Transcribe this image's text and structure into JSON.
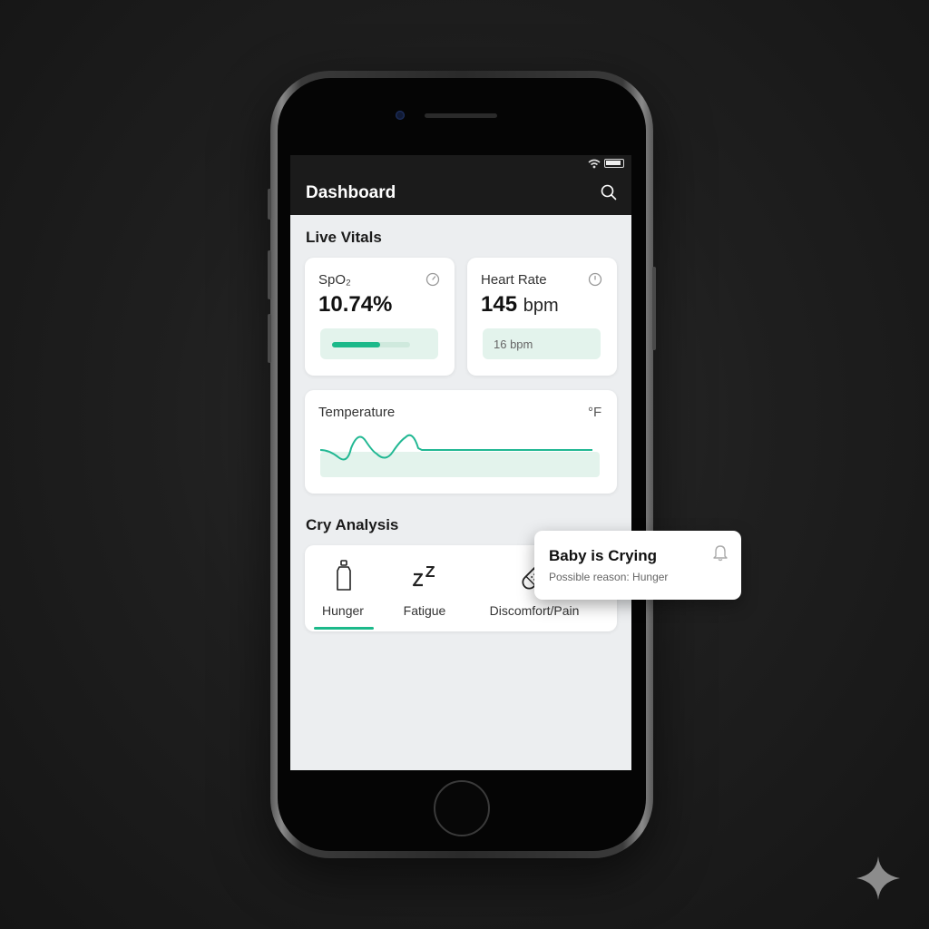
{
  "status_bar": {
    "wifi_icon": "wifi-icon",
    "battery_icon": "battery-icon"
  },
  "app_bar": {
    "title": "Dashboard",
    "search_icon": "search-icon"
  },
  "live_vitals": {
    "title": "Live Vitals",
    "spo2": {
      "label": "SpO₂",
      "value": "10.74%",
      "progress": 0.62,
      "icon": "gauge-icon"
    },
    "heart_rate": {
      "label": "Heart Rate",
      "value": "145",
      "unit": "bpm",
      "sub_value": "16 bpm",
      "icon": "clock-icon"
    },
    "temperature": {
      "label": "Temperature",
      "unit": "°F"
    }
  },
  "cry_analysis": {
    "title": "Cry Analysis",
    "items": [
      {
        "label": "Hunger",
        "icon": "bottle-icon",
        "active": true
      },
      {
        "label": "Fatigue",
        "icon": "sleep-zz-icon",
        "active": false
      },
      {
        "label": "Discomfort/Pain",
        "icon": "bandage-icon",
        "active": false
      }
    ]
  },
  "notification": {
    "title": "Baby is Crying",
    "message": "Possible reason: Hunger",
    "icon": "bell-icon"
  },
  "colors": {
    "accent": "#1cb98a",
    "accent_light": "#e3f3ec",
    "app_bar": "#1b1b1b",
    "screen_bg": "#eceef0"
  }
}
